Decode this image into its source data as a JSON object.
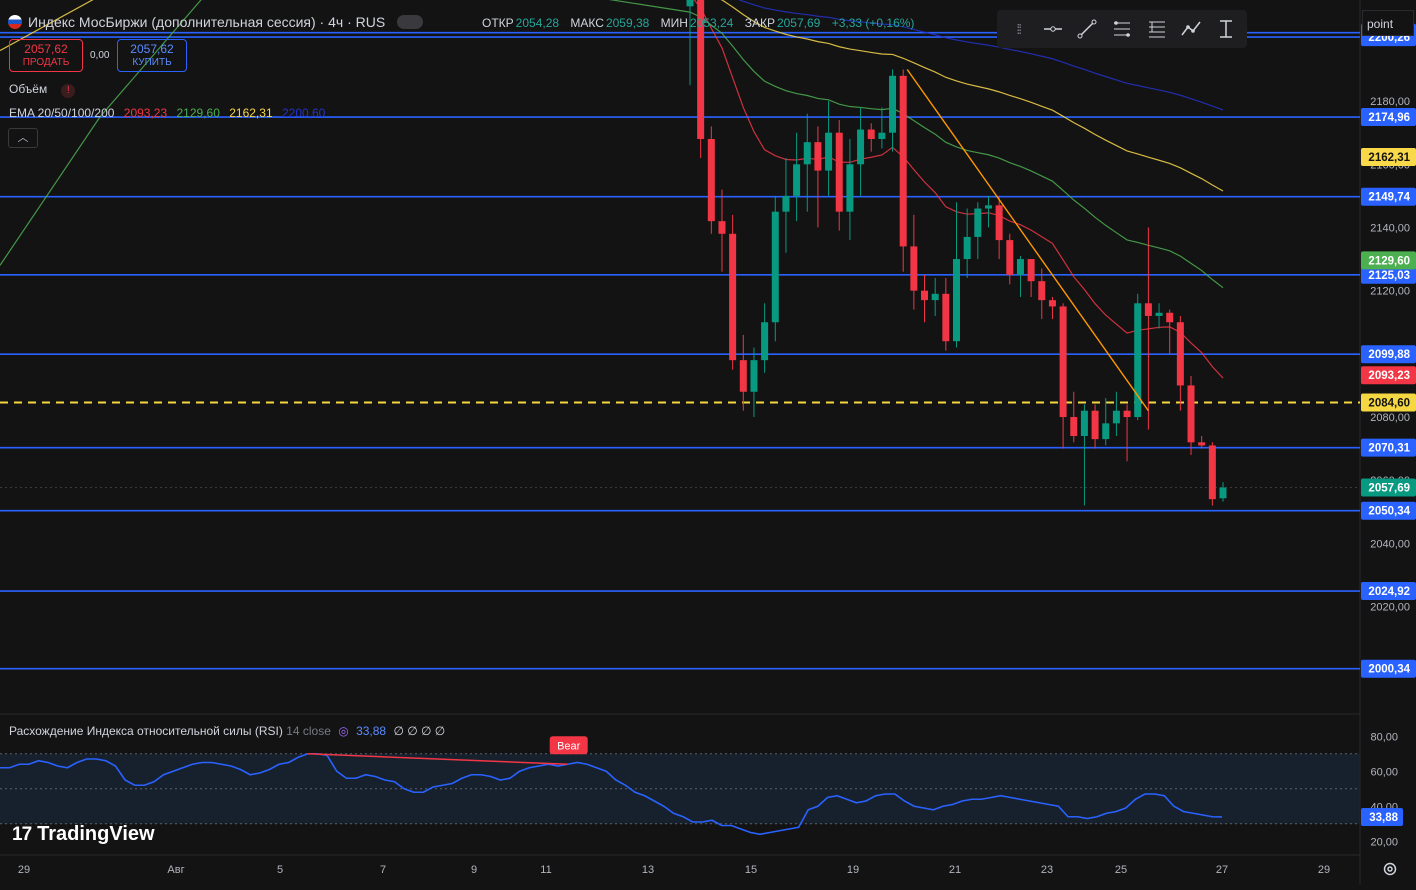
{
  "header": {
    "title": "Индекс МосБиржи (дополнительная сессия) · 4ч · RUS",
    "ohlc": [
      {
        "key": "ОТКР",
        "value": "2054,28"
      },
      {
        "key": "МАКС",
        "value": "2059,38"
      },
      {
        "key": "МИН",
        "value": "2053,24"
      },
      {
        "key": "ЗАКР",
        "value": "2057,69"
      }
    ],
    "change": "+3,33 (+0,16%)"
  },
  "trade": {
    "sell_price": "2057,62",
    "sell_label": "ПРОДАТЬ",
    "spread": "0,00",
    "buy_price": "2057,62",
    "buy_label": "КУПИТЬ"
  },
  "volume_label": "Объём",
  "ema": {
    "label": "EMA 20/50/100/200",
    "values": [
      "2093,23",
      "2129,60",
      "2162,31",
      "2200,60"
    ],
    "colors": [
      "#f23645",
      "#4caf50",
      "#f9d84a",
      "#2432c8"
    ]
  },
  "toolbar": {
    "icons": [
      "grip-icon",
      "horizontal-ray-icon",
      "trend-line-icon",
      "fib-retracement-icon",
      "fib-extension-icon",
      "path-icon",
      "vertical-measure-icon"
    ],
    "point_label": "point"
  },
  "rsi": {
    "title": "Расхождение Индекса относительной силы (RSI)",
    "params": "14 close",
    "value": "33,88",
    "extras": "∅ ∅ ∅ ∅",
    "bear_label": "Bear",
    "axis_ticks": [
      "80,00",
      "60,00",
      "40,00",
      "20,00"
    ],
    "band_levels": [
      70,
      30
    ],
    "mid_level": 50
  },
  "branding": "TradingView",
  "colors": {
    "bull": "#089981",
    "bear": "#f23645",
    "level": "#2962ff",
    "dashed": "#f5d742",
    "background": "#131314",
    "trend": "#ff9800"
  },
  "chart_data": [
    {
      "type": "candlestick",
      "ylim": [
        1986,
        2212
      ],
      "x_ticks": [
        "29",
        "Авг",
        "5",
        "7",
        "9",
        "11",
        "13",
        "15",
        "19",
        "21",
        "23",
        "25",
        "27",
        "29"
      ],
      "y_ticks": [
        "2180,00",
        "2160,00",
        "2140,00",
        "2120,00",
        "2100,00",
        "2080,00",
        "2060,00",
        "2040,00",
        "2020,00",
        "2000,00"
      ],
      "levels": [
        {
          "value": 2201.64,
          "label": "2201,64"
        },
        {
          "value": 2200.26,
          "label": "2200,26"
        },
        {
          "value": 2174.96,
          "label": "2174,96"
        },
        {
          "value": 2149.74,
          "label": "2149,74"
        },
        {
          "value": 2125.03,
          "label": "2125,03"
        },
        {
          "value": 2099.88,
          "label": "2099,88"
        },
        {
          "value": 2070.31,
          "label": "2070,31"
        },
        {
          "value": 2050.34,
          "label": "2050,34"
        },
        {
          "value": 2024.92,
          "label": "2024,92"
        },
        {
          "value": 2000.34,
          "label": "2000,34"
        }
      ],
      "dashed_level": {
        "value": 2084.6,
        "label": "2084,60"
      },
      "last_price": {
        "value": 2057.69,
        "label": "2057,69"
      },
      "ema_tags": [
        {
          "value": 2162.31,
          "label": "2162,31"
        },
        {
          "value": 2129.6,
          "label": "2129,60"
        },
        {
          "value": 2093.23,
          "label": "2093,23"
        }
      ],
      "candles": [
        [
          2210,
          2240,
          2185,
          2212
        ],
        [
          2212,
          2214,
          2162,
          2168
        ],
        [
          2168,
          2172,
          2138,
          2142
        ],
        [
          2142,
          2152,
          2126,
          2138
        ],
        [
          2138,
          2144,
          2095,
          2098
        ],
        [
          2098,
          2106,
          2082,
          2088
        ],
        [
          2088,
          2102,
          2080,
          2098
        ],
        [
          2098,
          2116,
          2094,
          2110
        ],
        [
          2110,
          2150,
          2104,
          2145
        ],
        [
          2145,
          2162,
          2132,
          2150
        ],
        [
          2150,
          2170,
          2142,
          2160
        ],
        [
          2160,
          2176,
          2145,
          2167
        ],
        [
          2167,
          2172,
          2140,
          2158
        ],
        [
          2158,
          2180,
          2150,
          2170
        ],
        [
          2170,
          2174,
          2139,
          2145
        ],
        [
          2145,
          2168,
          2136,
          2160
        ],
        [
          2160,
          2178,
          2150,
          2171
        ],
        [
          2171,
          2173,
          2164,
          2168
        ],
        [
          2168,
          2178,
          2165,
          2170
        ],
        [
          2170,
          2190,
          2164,
          2188
        ],
        [
          2188,
          2190,
          2126,
          2134
        ],
        [
          2134,
          2144,
          2114,
          2120
        ],
        [
          2120,
          2125,
          2110,
          2117
        ],
        [
          2117,
          2124,
          2112,
          2119
        ],
        [
          2119,
          2124,
          2101,
          2104
        ],
        [
          2104,
          2148,
          2102,
          2130
        ],
        [
          2130,
          2146,
          2124,
          2137
        ],
        [
          2137,
          2148,
          2130,
          2146
        ],
        [
          2146,
          2150,
          2140,
          2147
        ],
        [
          2147,
          2150,
          2130,
          2136
        ],
        [
          2136,
          2138,
          2122,
          2125
        ],
        [
          2125,
          2131,
          2118,
          2130
        ],
        [
          2130,
          2130,
          2118,
          2123
        ],
        [
          2123,
          2127,
          2111,
          2117
        ],
        [
          2117,
          2118,
          2111,
          2115
        ],
        [
          2115,
          2116,
          2070,
          2080
        ],
        [
          2080,
          2088,
          2072,
          2074
        ],
        [
          2074,
          2084,
          2052,
          2082
        ],
        [
          2082,
          2084,
          2070,
          2073
        ],
        [
          2073,
          2086,
          2071,
          2078
        ],
        [
          2078,
          2088,
          2074,
          2082
        ],
        [
          2082,
          2084,
          2066,
          2080
        ],
        [
          2080,
          2119,
          2079,
          2116
        ],
        [
          2116,
          2140,
          2076,
          2112
        ],
        [
          2112,
          2116,
          2108,
          2113
        ],
        [
          2113,
          2114,
          2100,
          2110
        ],
        [
          2110,
          2112,
          2082,
          2090
        ],
        [
          2090,
          2093,
          2068,
          2072
        ],
        [
          2072,
          2074,
          2070,
          2071
        ],
        [
          2071,
          2072,
          2052,
          2054
        ],
        [
          2054.28,
          2059.38,
          2053.24,
          2057.69
        ]
      ]
    },
    {
      "type": "line",
      "name": "RSI",
      "ylim": [
        15,
        87
      ],
      "values": [
        62,
        62,
        64,
        64,
        66,
        65,
        63,
        62,
        65,
        67,
        67,
        66,
        63,
        55,
        52,
        52,
        54,
        58,
        60,
        62,
        64,
        65,
        65,
        64,
        63,
        61,
        58,
        59,
        61,
        64,
        65,
        68,
        70,
        70,
        69,
        60,
        56,
        56,
        58,
        57,
        55,
        54,
        50,
        48,
        48,
        51,
        52,
        53,
        56,
        58,
        58,
        57,
        55,
        56,
        60,
        62,
        63,
        64,
        63,
        64,
        65,
        64,
        62,
        60,
        55,
        52,
        48,
        46,
        43,
        40,
        36,
        34,
        31,
        31,
        32,
        29,
        29,
        27,
        25,
        24,
        25,
        26,
        27,
        28,
        38,
        40,
        45,
        46,
        44,
        42,
        43,
        46,
        47,
        47,
        43,
        40,
        39,
        38,
        40,
        41,
        43,
        44,
        44,
        45,
        46,
        45,
        44,
        43,
        42,
        41,
        40,
        34,
        34,
        33,
        34,
        36,
        37,
        39,
        44,
        47,
        47,
        46,
        40,
        37,
        36,
        35,
        34,
        33.88
      ]
    }
  ]
}
